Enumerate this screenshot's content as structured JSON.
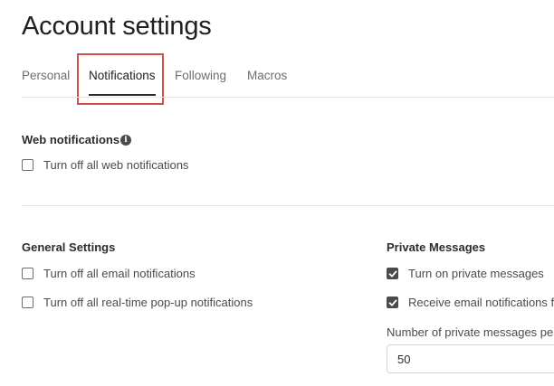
{
  "page": {
    "title": "Account settings"
  },
  "tabs": [
    {
      "label": "Personal",
      "active": false
    },
    {
      "label": "Notifications",
      "active": true
    },
    {
      "label": "Following",
      "active": false
    },
    {
      "label": "Macros",
      "active": false
    }
  ],
  "web_notifications": {
    "heading": "Web notifications",
    "info_icon": "info-icon",
    "options": [
      {
        "label": "Turn off all web notifications",
        "checked": false
      }
    ]
  },
  "general_settings": {
    "heading": "General Settings",
    "options": [
      {
        "label": "Turn off all email notifications",
        "checked": false
      },
      {
        "label": "Turn off all real-time pop-up notifications",
        "checked": false
      }
    ]
  },
  "private_messages": {
    "heading": "Private Messages",
    "options": [
      {
        "label": "Turn on private messages",
        "checked": true
      },
      {
        "label": "Receive email notifications fo",
        "checked": true
      }
    ],
    "per_page_label": "Number of private messages per",
    "per_page_value": "50"
  },
  "colors": {
    "highlight": "#d0504c",
    "checkbox_checked": "#4b4b4b",
    "divider": "#e6e6e6"
  }
}
